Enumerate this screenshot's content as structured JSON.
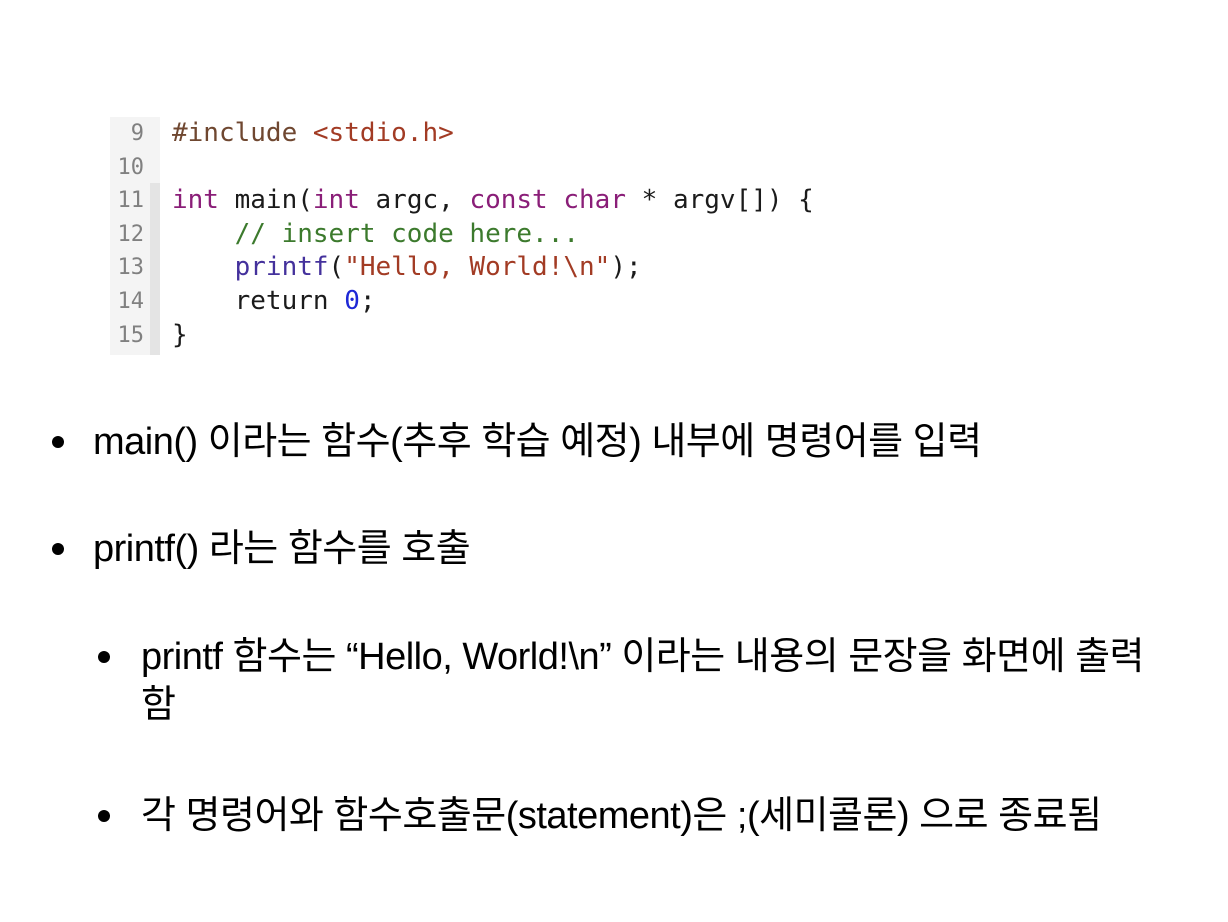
{
  "code": {
    "lines": [
      {
        "num": "9",
        "tokens": [
          {
            "t": "#include ",
            "k": "directive"
          },
          {
            "t": "<stdio.h>",
            "k": "header"
          }
        ]
      },
      {
        "num": "10",
        "tokens": []
      },
      {
        "num": "11",
        "tokens": [
          {
            "t": "int",
            "k": "keyword"
          },
          {
            "t": " main(",
            "k": "plain"
          },
          {
            "t": "int",
            "k": "keyword"
          },
          {
            "t": " argc, ",
            "k": "plain"
          },
          {
            "t": "const",
            "k": "keyword"
          },
          {
            "t": " ",
            "k": "plain"
          },
          {
            "t": "char",
            "k": "keyword"
          },
          {
            "t": " * argv[]) {",
            "k": "plain"
          }
        ]
      },
      {
        "num": "12",
        "tokens": [
          {
            "t": "    ",
            "k": "plain"
          },
          {
            "t": "// insert code here...",
            "k": "comment"
          }
        ]
      },
      {
        "num": "13",
        "tokens": [
          {
            "t": "    ",
            "k": "plain"
          },
          {
            "t": "printf",
            "k": "func"
          },
          {
            "t": "(",
            "k": "plain"
          },
          {
            "t": "\"Hello, World!\\n\"",
            "k": "string"
          },
          {
            "t": ");",
            "k": "plain"
          }
        ]
      },
      {
        "num": "14",
        "tokens": [
          {
            "t": "    return ",
            "k": "plain"
          },
          {
            "t": "0",
            "k": "number"
          },
          {
            "t": ";",
            "k": "plain"
          }
        ]
      },
      {
        "num": "15",
        "tokens": [
          {
            "t": "}",
            "k": "plain"
          }
        ]
      }
    ]
  },
  "bullets": [
    {
      "text": "main() 이라는 함수(추후 학습 예정) 내부에 명령어를 입력",
      "level": 1
    },
    {
      "text": "printf() 라는 함수를 호출",
      "level": 1
    },
    {
      "text": "printf 함수는 “Hello, World!\\n” 이라는 내용의 문장을 화면에 출력함",
      "level": 2
    },
    {
      "text": "각 명령어와 함수호출문(statement)은 ;(세미콜론) 으로 종료됨",
      "level": 2
    }
  ]
}
